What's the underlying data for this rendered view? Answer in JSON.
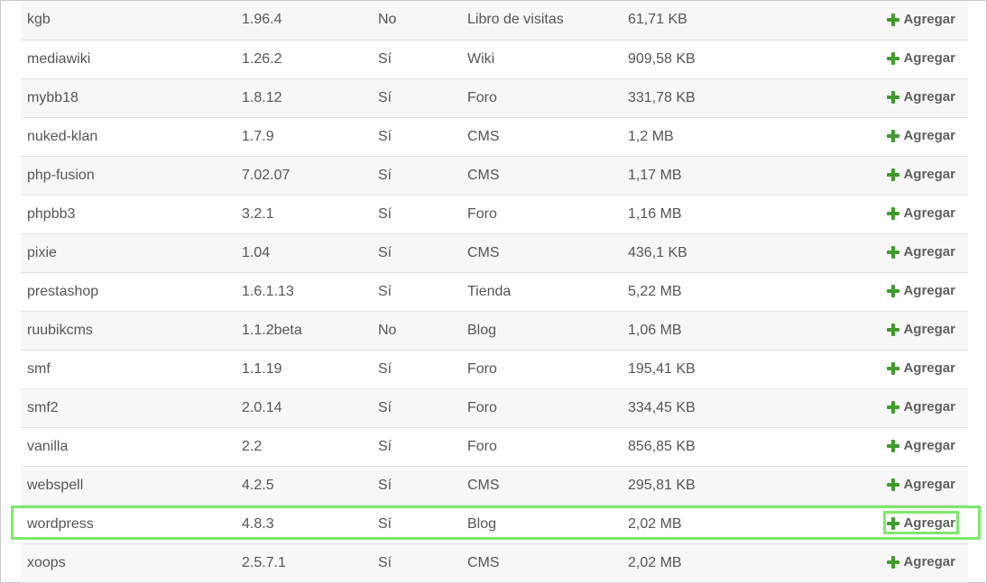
{
  "action_label": "Agregar",
  "action_icon": "plus-icon",
  "accent_color": "#3f9c2c",
  "highlight_color": "#7fe86a",
  "rows": [
    {
      "name": "kgb",
      "version": "1.96.4",
      "ssl": "No",
      "category": "Libro de visitas",
      "size": "61,71 KB"
    },
    {
      "name": "mediawiki",
      "version": "1.26.2",
      "ssl": "Sí",
      "category": "Wiki",
      "size": "909,58 KB"
    },
    {
      "name": "mybb18",
      "version": "1.8.12",
      "ssl": "Sí",
      "category": "Foro",
      "size": "331,78 KB"
    },
    {
      "name": "nuked-klan",
      "version": "1.7.9",
      "ssl": "Sí",
      "category": "CMS",
      "size": "1,2 MB"
    },
    {
      "name": "php-fusion",
      "version": "7.02.07",
      "ssl": "Sí",
      "category": "CMS",
      "size": "1,17 MB"
    },
    {
      "name": "phpbb3",
      "version": "3.2.1",
      "ssl": "Sí",
      "category": "Foro",
      "size": "1,16 MB"
    },
    {
      "name": "pixie",
      "version": "1.04",
      "ssl": "Sí",
      "category": "CMS",
      "size": "436,1 KB"
    },
    {
      "name": "prestashop",
      "version": "1.6.1.13",
      "ssl": "Sí",
      "category": "Tienda",
      "size": "5,22 MB"
    },
    {
      "name": "ruubikcms",
      "version": "1.1.2beta",
      "ssl": "No",
      "category": "Blog",
      "size": "1,06 MB"
    },
    {
      "name": "smf",
      "version": "1.1.19",
      "ssl": "Sí",
      "category": "Foro",
      "size": "195,41 KB"
    },
    {
      "name": "smf2",
      "version": "2.0.14",
      "ssl": "Sí",
      "category": "Foro",
      "size": "334,45 KB"
    },
    {
      "name": "vanilla",
      "version": "2.2",
      "ssl": "Sí",
      "category": "Foro",
      "size": "856,85 KB"
    },
    {
      "name": "webspell",
      "version": "4.2.5",
      "ssl": "Sí",
      "category": "CMS",
      "size": "295,81 KB"
    },
    {
      "name": "wordpress",
      "version": "4.8.3",
      "ssl": "Sí",
      "category": "Blog",
      "size": "2,02 MB"
    },
    {
      "name": "xoops",
      "version": "2.5.7.1",
      "ssl": "Sí",
      "category": "CMS",
      "size": "2,02 MB"
    }
  ]
}
